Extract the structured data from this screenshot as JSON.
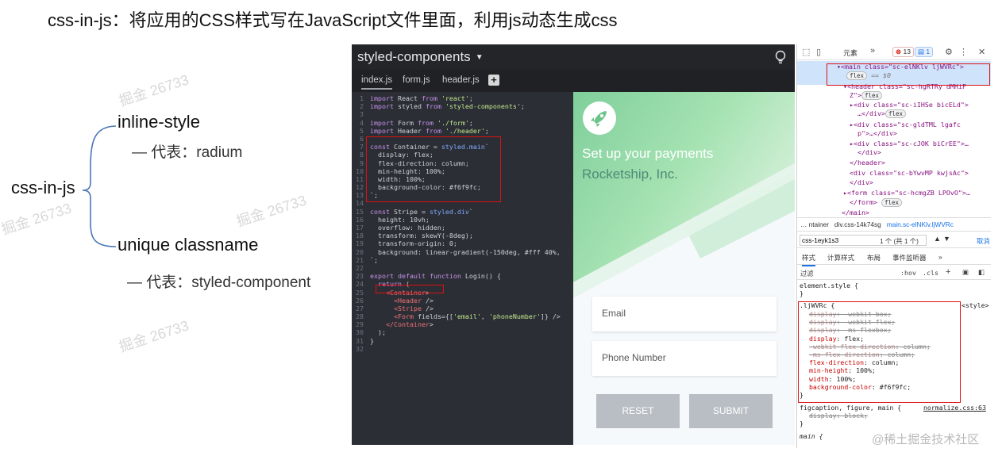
{
  "slide": {
    "title": "css-in-js：将应用的CSS样式写在JavaScript文件里面，利用js动态生成css",
    "mindmap": {
      "root": "css-in-js",
      "branches": [
        {
          "label": "inline-style",
          "note": "— 代表：radium"
        },
        {
          "label": "unique classname",
          "note": "— 代表：styled-component"
        }
      ]
    },
    "watermark": "掘金 26733",
    "footer_mark": "@稀土掘金技术社区"
  },
  "editor": {
    "title": "styled-components",
    "tabs": [
      "index.js",
      "form.js",
      "header.js"
    ],
    "code": [
      [
        "1",
        "import React from 'react';"
      ],
      [
        "2",
        "import styled from 'styled-components';"
      ],
      [
        "3",
        ""
      ],
      [
        "4",
        "import Form from './form';"
      ],
      [
        "5",
        "import Header from './header';"
      ],
      [
        "6",
        ""
      ],
      [
        "7",
        "const Container = styled.main`"
      ],
      [
        "8",
        "  display: flex;"
      ],
      [
        "9",
        "  flex-direction: column;"
      ],
      [
        "10",
        "  min-height: 100%;"
      ],
      [
        "11",
        "  width: 100%;"
      ],
      [
        "12",
        "  background-color: #f6f9fc;"
      ],
      [
        "13",
        "`;"
      ],
      [
        "14",
        ""
      ],
      [
        "15",
        "const Stripe = styled.div`"
      ],
      [
        "16",
        "  height: 10vh;"
      ],
      [
        "17",
        "  overflow: hidden;"
      ],
      [
        "18",
        "  transform: skewY(-8deg);"
      ],
      [
        "19",
        "  transform-origin: 0;"
      ],
      [
        "20",
        "  background: linear-gradient(-150deg, #fff 40%,"
      ],
      [
        "21",
        "`;"
      ],
      [
        "22",
        ""
      ],
      [
        "23",
        "export default function Login() {"
      ],
      [
        "24",
        "  return ("
      ],
      [
        "25",
        "    <Container>"
      ],
      [
        "26",
        "      <Header />"
      ],
      [
        "27",
        "      <Stripe />"
      ],
      [
        "28",
        "      <Form fields={['email', 'phoneNumber']} />"
      ],
      [
        "29",
        "    </Container>"
      ],
      [
        "30",
        "  );"
      ],
      [
        "31",
        "}"
      ],
      [
        "32",
        ""
      ]
    ],
    "preview": {
      "heading": "Set up your payments",
      "company": "Rocketship, Inc.",
      "email_placeholder": "Email",
      "phone_placeholder": "Phone Number",
      "reset_label": "RESET",
      "submit_label": "SUBMIT"
    }
  },
  "devtools": {
    "elements_tab": "元素",
    "error_count": "13",
    "message_count": "1",
    "dom": [
      "<main class=\"sc-elNKlv ljWVRc\">",
      "flex",
      "== $0",
      "<header class=\"sc-hgRTRy dMHiF",
      "Z\">",
      "<div class=\"sc-iIHSe bicELd\">",
      "…</div>",
      "<div class=\"sc-gldTML lgafc",
      "p\">…</div>",
      "<div class=\"sc-cJOK biCrEE\">…",
      "</div>",
      "</header>",
      "<div class=\"sc-bYwvMP kwjsAc\">",
      "</div>",
      "<form class=\"sc-hcmgZB LPOvO\">…",
      "</form>",
      "</main>"
    ],
    "breadcrumbs": [
      "…  ntainer",
      "div.css-14k74sg",
      "main.sc-elNKlv.ljWVRc"
    ],
    "search_value": "css-1eyk1s3",
    "search_count": "1 个 (共 1 个)",
    "search_cancel": "取消",
    "style_tabs": [
      "样式",
      "计算样式",
      "布局",
      "事件监听器"
    ],
    "filter_label": "过滤",
    "filter_tools": [
      ":hov",
      ".cls",
      "+"
    ],
    "element_style": "element.style {",
    "rule_selector": ".ljWVRc {",
    "rule_source": "<style>",
    "rule_props": [
      {
        "name": "display",
        "value": "-webkit-box;",
        "struck": true
      },
      {
        "name": "display",
        "value": "-webkit-flex;",
        "struck": true
      },
      {
        "name": "display",
        "value": "-ms-flexbox;",
        "struck": true
      },
      {
        "name": "display",
        "value": "flex;",
        "struck": false
      },
      {
        "name": "-webkit-flex-direction",
        "value": "column;",
        "struck": true
      },
      {
        "name": "-ms-flex-direction",
        "value": "column;",
        "struck": true
      },
      {
        "name": "flex-direction",
        "value": "column;",
        "struck": false
      },
      {
        "name": "min-height",
        "value": "100%;",
        "struck": false
      },
      {
        "name": "width",
        "value": "100%;",
        "struck": false
      },
      {
        "name": "background-color",
        "value": "#f6f9fc;",
        "struck": false
      }
    ],
    "rule2_selector": "figcaption, figure, main {",
    "rule2_source": "normalize.css:63",
    "rule2_prop": "display: block;",
    "rule3_selector": "main {",
    "close_brace": "}"
  },
  "colors": {
    "editor_bg": "#2b2e35",
    "highlight_red": "#dd1111",
    "preview_bg": "#f6f9fc",
    "green_gradient": "#8fd6a6"
  }
}
